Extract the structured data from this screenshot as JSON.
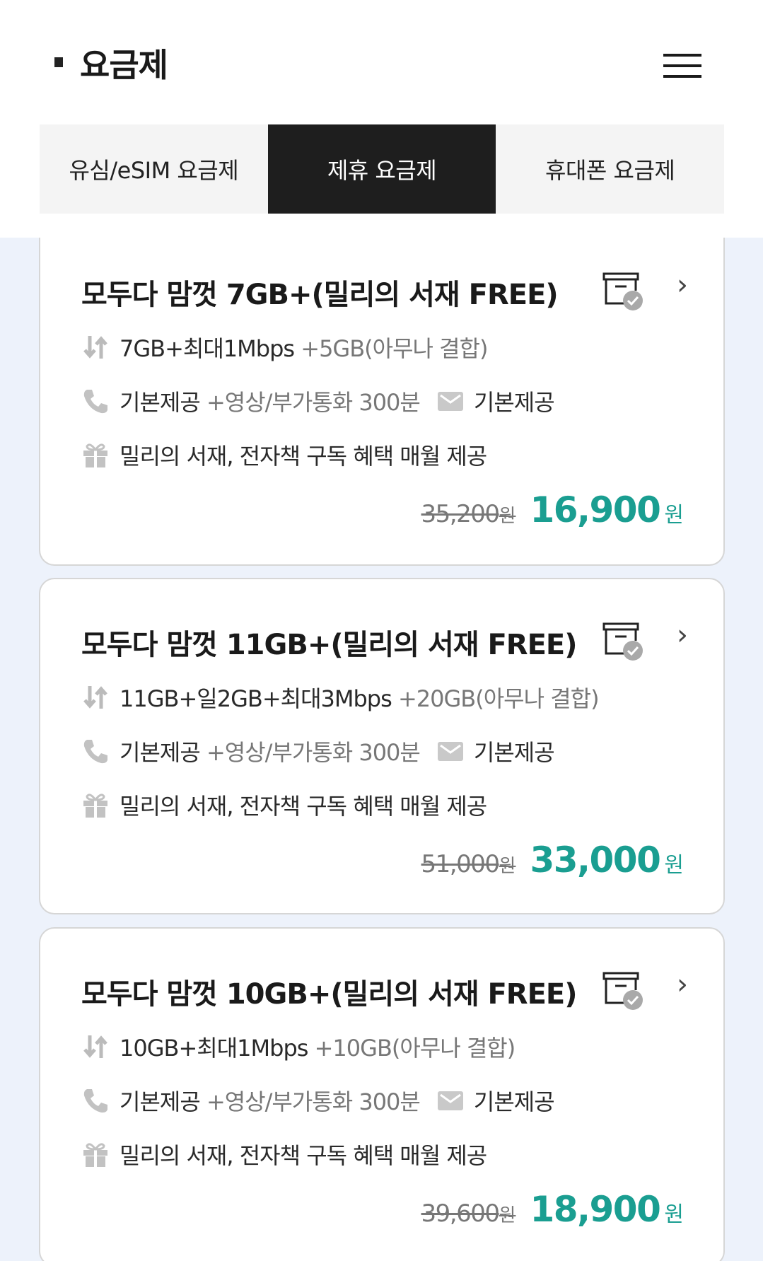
{
  "header": {
    "title": "요금제"
  },
  "tabs": [
    {
      "label": "유심/eSIM 요금제",
      "active": false
    },
    {
      "label": "제휴 요금제",
      "active": true
    },
    {
      "label": "휴대폰 요금제",
      "active": false
    }
  ],
  "plans": [
    {
      "name": "모두다 맘껏 7GB+(밀리의 서재 FREE)",
      "data_main": "7GB+최대1Mbps",
      "data_extra": "+5GB(아무나 결합)",
      "voice_main": "기본제공",
      "voice_extra": "+영상/부가통화 300분",
      "sms": "기본제공",
      "benefit": "밀리의 서재, 전자책 구독 혜택 매월 제공",
      "original_price": "35,200",
      "price": "16,900",
      "currency": "원"
    },
    {
      "name": "모두다 맘껏 11GB+(밀리의 서재 FREE)",
      "data_main": "11GB+일2GB+최대3Mbps",
      "data_extra": "+20GB(아무나 결합)",
      "voice_main": "기본제공",
      "voice_extra": "+영상/부가통화 300분",
      "sms": "기본제공",
      "benefit": "밀리의 서재, 전자책 구독 혜택 매월 제공",
      "original_price": "51,000",
      "price": "33,000",
      "currency": "원"
    },
    {
      "name": "모두다 맘껏 10GB+(밀리의 서재 FREE)",
      "data_main": "10GB+최대1Mbps",
      "data_extra": "+10GB(아무나 결합)",
      "voice_main": "기본제공",
      "voice_extra": "+영상/부가통화 300분",
      "sms": "기본제공",
      "benefit": "밀리의 서재, 전자책 구독 혜택 매월 제공",
      "original_price": "39,600",
      "price": "18,900",
      "currency": "원"
    }
  ],
  "icons": {
    "chevron": "›",
    "accent_color": "#1a9e91"
  }
}
